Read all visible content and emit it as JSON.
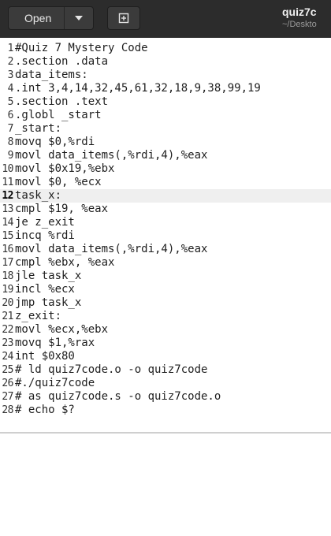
{
  "titlebar": {
    "open_label": "Open",
    "title": "quiz7c",
    "subtitle": "~/Deskto",
    "icons": {
      "dropdown": "chevron-down-icon",
      "new_document": "new-document-icon"
    },
    "background_color": "#2c2c2c"
  },
  "editor": {
    "current_line": 12,
    "lines": [
      {
        "number": "1",
        "text": "#Quiz 7 Mystery Code"
      },
      {
        "number": "2",
        "text": ".section .data"
      },
      {
        "number": "3",
        "text": "data_items:"
      },
      {
        "number": "4",
        "text": ".int 3,4,14,32,45,61,32,18,9,38,99,19"
      },
      {
        "number": "5",
        "text": ".section .text"
      },
      {
        "number": "6",
        "text": ".globl _start"
      },
      {
        "number": "7",
        "text": "_start:"
      },
      {
        "number": "8",
        "text": "movq $0,%rdi"
      },
      {
        "number": "9",
        "text": "movl data_items(,%rdi,4),%eax"
      },
      {
        "number": "10",
        "text": "movl $0x19,%ebx"
      },
      {
        "number": "11",
        "text": "movl $0, %ecx"
      },
      {
        "number": "12",
        "text": "task_x:"
      },
      {
        "number": "13",
        "text": "cmpl $19, %eax"
      },
      {
        "number": "14",
        "text": "je z_exit"
      },
      {
        "number": "15",
        "text": "incq %rdi"
      },
      {
        "number": "16",
        "text": "movl data_items(,%rdi,4),%eax"
      },
      {
        "number": "17",
        "text": "cmpl %ebx, %eax"
      },
      {
        "number": "18",
        "text": "jle task_x"
      },
      {
        "number": "19",
        "text": "incl %ecx"
      },
      {
        "number": "20",
        "text": "jmp task_x"
      },
      {
        "number": "21",
        "text": "z_exit:"
      },
      {
        "number": "22",
        "text": "movl %ecx,%ebx"
      },
      {
        "number": "23",
        "text": "movq $1,%rax"
      },
      {
        "number": "24",
        "text": "int $0x80"
      },
      {
        "number": "25",
        "text": "# ld quiz7code.o -o quiz7code"
      },
      {
        "number": "26",
        "text": "#./quiz7code"
      },
      {
        "number": "27",
        "text": "# as quiz7code.s -o quiz7code.o"
      },
      {
        "number": "28",
        "text": "# echo $?"
      }
    ]
  }
}
